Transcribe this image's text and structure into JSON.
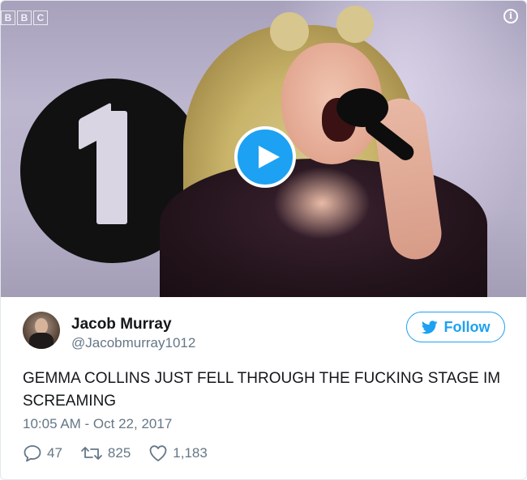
{
  "media": {
    "broadcaster_letters": [
      "B",
      "B",
      "C"
    ],
    "play_icon": "play-icon",
    "info_icon": "info-icon",
    "info_glyph": "i"
  },
  "tweet": {
    "author_name": "Jacob Murray",
    "author_handle": "@Jacobmurray1012",
    "follow_label": "Follow",
    "text": "GEMMA COLLINS JUST FELL THROUGH THE FUCKING STAGE IM SCREAMING",
    "timestamp": "10:05 AM - Oct 22, 2017",
    "replies": "47",
    "retweets": "825",
    "likes": "1,183"
  },
  "colors": {
    "accent": "#1da1f2",
    "muted": "#657786",
    "text": "#14171a",
    "border": "#e1e8ed"
  }
}
